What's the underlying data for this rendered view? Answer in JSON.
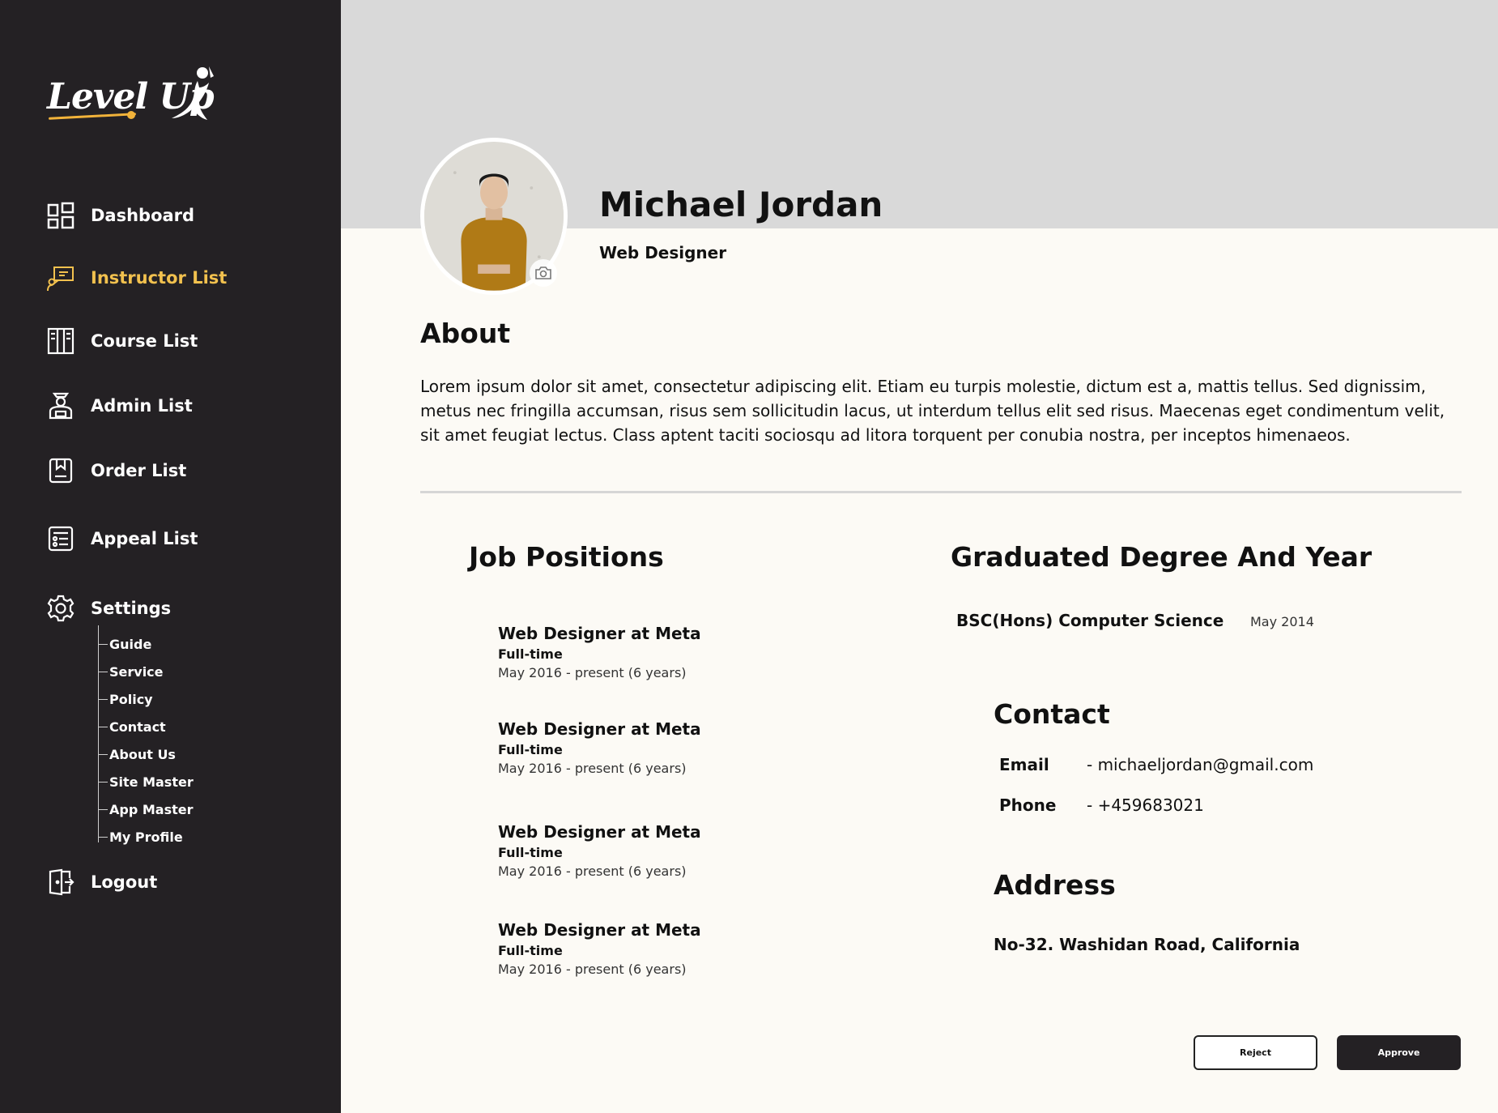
{
  "brand": {
    "name": "Level Up",
    "accent_color": "#f2c14e"
  },
  "sidebar": {
    "items": [
      {
        "label": "Dashboard",
        "icon": "dashboard-icon"
      },
      {
        "label": "Instructor List",
        "icon": "instructor-icon",
        "active": true
      },
      {
        "label": "Course List",
        "icon": "course-icon"
      },
      {
        "label": "Admin List",
        "icon": "admin-icon"
      },
      {
        "label": "Order List",
        "icon": "order-icon"
      },
      {
        "label": "Appeal List",
        "icon": "appeal-icon"
      },
      {
        "label": "Settings",
        "icon": "gear-icon"
      }
    ],
    "settings_subitems": [
      "Guide",
      "Service",
      "Policy",
      "Contact",
      "About Us",
      "Site Master",
      "App Master",
      "My Profile"
    ],
    "logout": {
      "label": "Logout",
      "icon": "logout-icon"
    }
  },
  "profile": {
    "name": "Michael Jordan",
    "role": "Web Designer",
    "about_title": "About",
    "about_text": "Lorem ipsum dolor sit amet, consectetur adipiscing elit. Etiam eu turpis molestie, dictum est a, mattis tellus. Sed dignissim, metus nec fringilla accumsan, risus sem sollicitudin lacus, ut interdum tellus elit sed risus. Maecenas eget condimentum velit, sit amet feugiat lectus. Class aptent taciti sociosqu ad litora torquent per conubia nostra, per inceptos himenaeos."
  },
  "jobs": {
    "title": "Job Positions",
    "items": [
      {
        "title": "Web Designer at Meta",
        "type": "Full-time",
        "date": "May 2016 - present (6 years)"
      },
      {
        "title": "Web Designer at Meta",
        "type": "Full-time",
        "date": "May 2016 - present (6 years)"
      },
      {
        "title": "Web Designer at Meta",
        "type": "Full-time",
        "date": "May 2016 - present (6 years)"
      },
      {
        "title": "Web Designer at Meta",
        "type": "Full-time",
        "date": "May 2016 - present (6 years)"
      }
    ]
  },
  "education": {
    "title": "Graduated Degree And Year",
    "degree": "BSC(Hons) Computer Science",
    "year": "May 2014"
  },
  "contact": {
    "title": "Contact",
    "email_label": "Email",
    "email_value": "- michaeljordan@gmail.com",
    "phone_label": "Phone",
    "phone_value": "- +459683021"
  },
  "address": {
    "title": "Address",
    "value": "No-32. Washidan Road, California"
  },
  "actions": {
    "reject_label": "Reject",
    "approve_label": "Approve"
  }
}
